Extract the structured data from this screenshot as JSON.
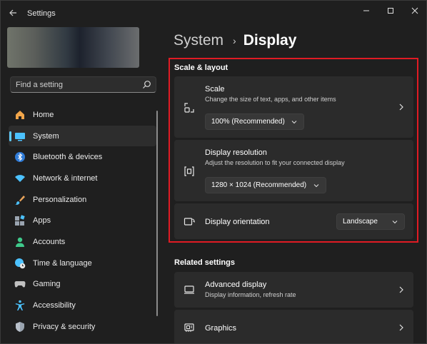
{
  "window": {
    "title": "Settings"
  },
  "search": {
    "placeholder": "Find a setting"
  },
  "sidebar": {
    "items": [
      {
        "label": "Home",
        "icon": "home-icon",
        "color": "#f1a54a"
      },
      {
        "label": "System",
        "icon": "system-icon",
        "color": "#4cc2ff",
        "selected": true
      },
      {
        "label": "Bluetooth & devices",
        "icon": "bluetooth-icon",
        "color": "#2f7bd7"
      },
      {
        "label": "Network & internet",
        "icon": "wifi-icon",
        "color": "#4cc2ff"
      },
      {
        "label": "Personalization",
        "icon": "brush-icon",
        "color": "#e8a35a"
      },
      {
        "label": "Apps",
        "icon": "apps-icon",
        "color": "#9aa4b0"
      },
      {
        "label": "Accounts",
        "icon": "accounts-icon",
        "color": "#3fc98b"
      },
      {
        "label": "Time & language",
        "icon": "globe-clock-icon",
        "color": "#4cc2ff"
      },
      {
        "label": "Gaming",
        "icon": "gamepad-icon",
        "color": "#c0c0c0"
      },
      {
        "label": "Accessibility",
        "icon": "accessibility-icon",
        "color": "#4cc2ff"
      },
      {
        "label": "Privacy & security",
        "icon": "shield-icon",
        "color": "#9aa4b0"
      }
    ]
  },
  "breadcrumb": {
    "parent": "System",
    "separator": "›",
    "current": "Display"
  },
  "scale_layout": {
    "heading": "Scale & layout",
    "scale": {
      "title": "Scale",
      "description": "Change the size of text, apps, and other items",
      "value": "100% (Recommended)"
    },
    "resolution": {
      "title": "Display resolution",
      "description": "Adjust the resolution to fit your connected display",
      "value": "1280 × 1024 (Recommended)"
    },
    "orientation": {
      "title": "Display orientation",
      "value": "Landscape"
    }
  },
  "related": {
    "heading": "Related settings",
    "advanced": {
      "title": "Advanced display",
      "description": "Display information, refresh rate"
    },
    "graphics": {
      "title": "Graphics"
    }
  },
  "colors": {
    "accent": "#60cdff",
    "highlight": "#e01b24",
    "card": "#2b2b2b",
    "background": "#1f1f1f"
  }
}
